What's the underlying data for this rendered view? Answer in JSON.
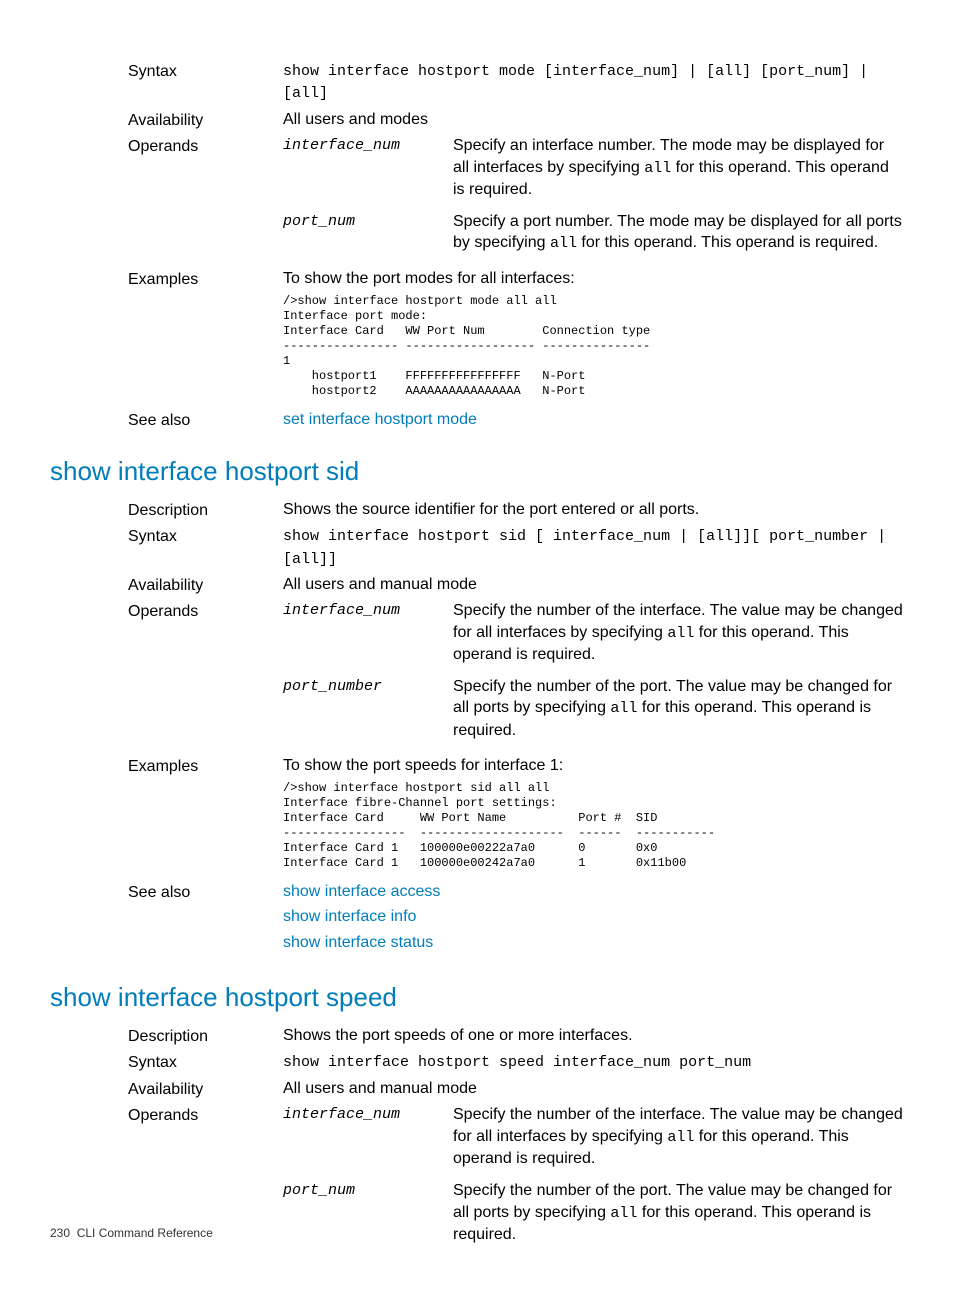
{
  "section1": {
    "syntax_label": "Syntax",
    "syntax_code": "show interface hostport mode [interface_num] | [all] [port_num] | [all]",
    "availability_label": "Availability",
    "availability_value": "All users and modes",
    "operands_label": "Operands",
    "operands": [
      {
        "name": "interface_num",
        "desc_pre": "Specify an interface number. The mode may be displayed for all interfaces by specifying ",
        "desc_code": "all",
        "desc_post": " for this operand. This operand is required."
      },
      {
        "name": "port_num",
        "desc_pre": "Specify a port number. The mode may be displayed for all ports by specifying ",
        "desc_code": "all",
        "desc_post": " for this operand. This operand is required."
      }
    ],
    "examples_label": "Examples",
    "examples_intro": "To show the port modes for all interfaces:",
    "examples_code": "/>show interface hostport mode all all\nInterface port mode:\nInterface Card   WW Port Num        Connection type\n---------------- ------------------ ---------------\n1\n    hostport1    FFFFFFFFFFFFFFFF   N-Port\n    hostport2    AAAAAAAAAAAAAAAA   N-Port",
    "see_also_label": "See also",
    "see_also_link": "set interface hostport mode"
  },
  "section2": {
    "heading": "show interface hostport sid",
    "description_label": "Description",
    "description_value": "Shows the source identifier for the port entered or all ports.",
    "syntax_label": "Syntax",
    "syntax_code": "show interface hostport sid [ interface_num | [all]][ port_number | [all]]",
    "availability_label": "Availability",
    "availability_value": "All users and manual mode",
    "operands_label": "Operands",
    "operands": [
      {
        "name": "interface_num",
        "desc_pre": "Specify the number of the interface. The value may be changed for all interfaces by specifying ",
        "desc_code": "all",
        "desc_post": " for this operand. This operand is required."
      },
      {
        "name": "port_number",
        "desc_pre": "Specify the number of the port. The value may be changed for all ports by specifying ",
        "desc_code": "all",
        "desc_post": " for this operand. This operand is required."
      }
    ],
    "examples_label": "Examples",
    "examples_intro": "To show the port speeds for interface 1:",
    "examples_code": "/>show interface hostport sid all all\nInterface fibre-Channel port settings:\nInterface Card     WW Port Name          Port #  SID\n-----------------  --------------------  ------  -----------\nInterface Card 1   100000e00222a7a0      0       0x0\nInterface Card 1   100000e00242a7a0      1       0x11b00",
    "see_also_label": "See also",
    "see_also_links": [
      "show interface access",
      "show interface info",
      "show interface status"
    ]
  },
  "section3": {
    "heading": "show interface hostport speed",
    "description_label": "Description",
    "description_value": "Shows the port speeds of one or more interfaces.",
    "syntax_label": "Syntax",
    "syntax_code_pre": "show interface hostport speed ",
    "syntax_code_i1": "interface_num",
    "syntax_code_sp": " ",
    "syntax_code_i2": "port_num",
    "availability_label": "Availability",
    "availability_value": "All users and manual mode",
    "operands_label": "Operands",
    "operands": [
      {
        "name": "interface_num",
        "desc_pre": "Specify the number of the interface. The value may be changed for all interfaces by specifying ",
        "desc_code": "all",
        "desc_post": " for this operand. This operand is required."
      },
      {
        "name": "port_num",
        "desc_pre": "Specify the number of the port. The value may be changed for all ports by specifying ",
        "desc_code": "all",
        "desc_post": " for this operand. This operand is required."
      }
    ]
  },
  "footer": {
    "page": "230",
    "title": "CLI Command Reference"
  }
}
